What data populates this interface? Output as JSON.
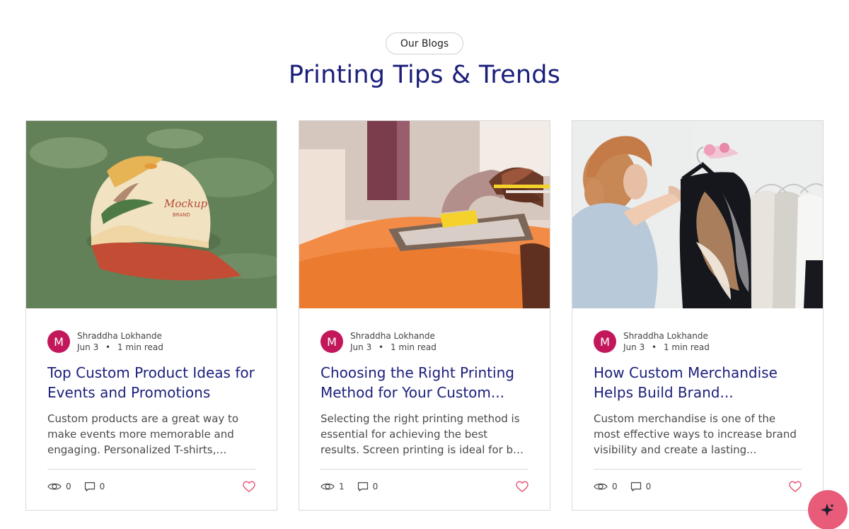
{
  "header": {
    "badge": "Our Blogs",
    "title": "Printing Tips & Trends"
  },
  "posts": [
    {
      "author": "Shraddha Lokhande",
      "avatar_letter": "M",
      "date": "Jun 3",
      "read_time": "1 min read",
      "title": "Top Custom Product Ideas for Events and Promotions",
      "excerpt": "Custom products are a great way to make events more memorable and engaging. Personalized T-shirts, caps,...",
      "views": "0",
      "comments": "0"
    },
    {
      "author": "Shraddha Lokhande",
      "avatar_letter": "M",
      "date": "Jun 3",
      "read_time": "1 min read",
      "title": "Choosing the Right Printing Method for Your Custom...",
      "excerpt": "Selecting the right printing method is essential for achieving the best results. Screen printing is ideal for bulk orders...",
      "views": "1",
      "comments": "0"
    },
    {
      "author": "Shraddha Lokhande",
      "avatar_letter": "M",
      "date": "Jun 3",
      "read_time": "1 min read",
      "title": "How Custom Merchandise Helps Build Brand...",
      "excerpt": "Custom merchandise is one of the most effective ways to increase brand visibility and create a lasting...",
      "views": "0",
      "comments": "0"
    }
  ],
  "icons": {
    "views": "eye-icon",
    "comments": "comment-icon",
    "like": "heart-icon",
    "assistant": "sparkle-icon"
  },
  "colors": {
    "title": "#1b1f7a",
    "avatar": "#c2185b",
    "like": "#e85b79",
    "fab": "#e85b79"
  }
}
